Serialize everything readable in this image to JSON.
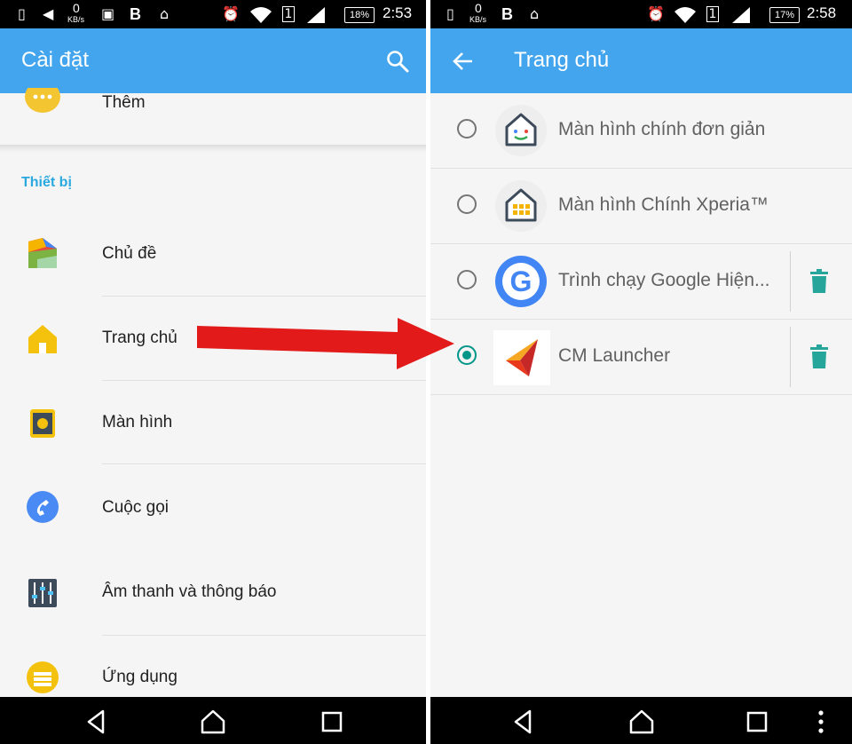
{
  "left": {
    "status": {
      "net_speed": "0",
      "net_unit": "KB/s",
      "b_label": "B",
      "battery": "18%",
      "time": "2:53"
    },
    "toolbar": {
      "title": "Cài đặt",
      "search_icon": "search-icon"
    },
    "partial_item": {
      "label": "Thêm",
      "icon": "more-dots-icon"
    },
    "section_header": "Thiết bị",
    "items": [
      {
        "label": "Chủ đề",
        "icon": "theme-icon"
      },
      {
        "label": "Trang chủ",
        "icon": "home-icon"
      },
      {
        "label": "Màn hình",
        "icon": "display-icon"
      },
      {
        "label": "Cuộc gọi",
        "icon": "phone-icon"
      },
      {
        "label": "Âm thanh và thông báo",
        "icon": "sound-icon"
      },
      {
        "label": "Ứng dụng",
        "icon": "apps-icon"
      }
    ]
  },
  "right": {
    "status": {
      "net_speed": "0",
      "net_unit": "KB/s",
      "b_label": "B",
      "battery": "17%",
      "time": "2:58"
    },
    "toolbar": {
      "title": "Trang chủ",
      "back_icon": "back-arrow-icon"
    },
    "launchers": [
      {
        "label": "Màn hình chính đơn giản",
        "selected": false,
        "icon": "simple-home-icon"
      },
      {
        "label": "Màn hình Chính  Xperia™",
        "selected": false,
        "icon": "xperia-home-icon"
      },
      {
        "label": "Trình chạy Google Hiện...",
        "selected": false,
        "icon": "google-g-icon",
        "deletable": true
      },
      {
        "label": "CM Launcher",
        "selected": true,
        "icon": "cm-launcher-icon",
        "deletable": true
      }
    ]
  },
  "colors": {
    "toolbar": "#43a5ee",
    "accent_teal": "#009688",
    "section_header": "#29a9e0",
    "arrow": "#e21a1a"
  }
}
